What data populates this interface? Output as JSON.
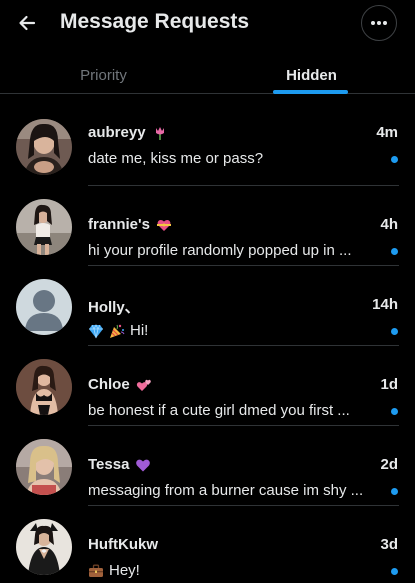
{
  "header": {
    "title": "Message Requests",
    "back_icon": "arrow-left-icon",
    "more_icon": "more-horizontal-icon"
  },
  "tabs": [
    {
      "label": "Priority",
      "selected": false
    },
    {
      "label": "Hidden",
      "selected": true
    }
  ],
  "colors": {
    "background": "#000000",
    "text_primary": "#e7e9ea",
    "text_secondary": "#71767b",
    "accent": "#1d9bf0",
    "divider": "#2f3336"
  },
  "conversations": [
    {
      "name": "aubreyy",
      "name_emoji": "tulip",
      "preview": "date me, kiss me or pass?",
      "preview_emojis": [],
      "time": "4m",
      "unread": true,
      "avatar": "photo"
    },
    {
      "name": "frannie's",
      "name_emoji": "heart-with-ribbon",
      "preview": "hi your profile randomly popped up in ...",
      "preview_emojis": [],
      "time": "4h",
      "unread": true,
      "avatar": "photo"
    },
    {
      "name": "Holly、",
      "name_emoji": "",
      "preview": "Hi!",
      "preview_emojis": [
        "gem",
        "party-popper"
      ],
      "time": "14h",
      "unread": true,
      "avatar": "default-profile"
    },
    {
      "name": "Chloe",
      "name_emoji": "two-hearts",
      "preview": "be honest if a cute girl dmed you first ...",
      "preview_emojis": [],
      "time": "1d",
      "unread": true,
      "avatar": "photo"
    },
    {
      "name": "Tessa",
      "name_emoji": "purple-heart",
      "preview": "messaging from a burner cause im shy ...",
      "preview_emojis": [],
      "time": "2d",
      "unread": true,
      "avatar": "photo"
    },
    {
      "name": "HuftKukw",
      "name_emoji": "",
      "preview": "Hey!",
      "preview_emojis": [
        "briefcase"
      ],
      "time": "3d",
      "unread": true,
      "avatar": "photo"
    }
  ]
}
